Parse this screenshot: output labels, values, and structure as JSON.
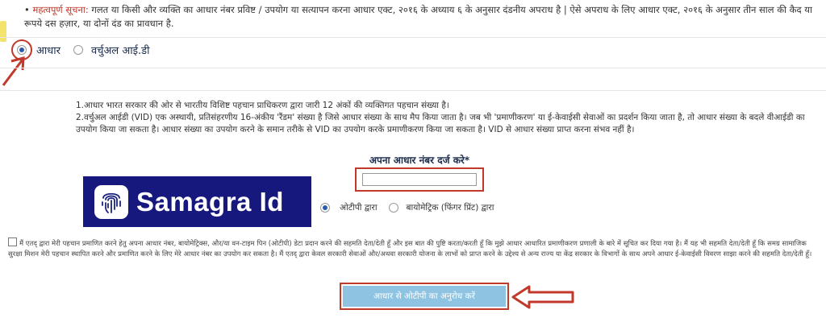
{
  "notice": {
    "label": "महत्वपूर्ण सूचना:",
    "text": "गलत या किसी और व्यक्ति का आधार नंबर प्रविष्ट / उपयोग या सत्यापन करना आधार एक्ट, २०१६ के अध्याय ६ के अनुसार दंडनीय अपराध है | ऐसे अपराध के लिए आधार एक्ट, २०१६ के अनुसार तीन साल की कैद या रूपये दस हज़ार, या दोनों दंड का प्रावधान है."
  },
  "id_type": {
    "options": [
      {
        "label": "आधार",
        "selected": true
      },
      {
        "label": "वर्चुअल आई.डी",
        "selected": false
      }
    ]
  },
  "info": {
    "line1": "1.आधार भारत सरकार की ओर से भारतीय विशिष्ट पहचान प्राधिकरण द्वारा जारी 12 अंकों की व्यक्तिगत पहचान संख्या है।",
    "line2": "2.वर्चुअल आईडी (VID) एक अस्थायी, प्रतिसंहरणीय 16-अंकीय 'रैंडम' संख्या है जिसे आधार संख्या के साथ मैप किया जाता है। जब भी 'प्रमाणीकरण' या ई-केवाईसी सेवाओं का प्रदर्शन किया जाता है, तो आधार संख्या के बदले वीआईडी का उपयोग किया जा सकता है। आधार संख्या का उपयोग करने के समान तरीके से VID का उपयोग करके प्रमाणीकरण किया जा सकता है। VID से आधार संख्या प्राप्त करना संभव नहीं है।"
  },
  "aadhaar_input": {
    "label": "अपना आधार नंबर दर्ज करे*",
    "value": "",
    "placeholder": ""
  },
  "logo": {
    "text": "Samagra Id",
    "icon": "fingerprint-icon"
  },
  "auth_method": {
    "options": [
      {
        "label": "ओटीपी द्वारा",
        "selected": true
      },
      {
        "label": "बायोमेट्रिक (फिंगर प्रिंट) द्वारा",
        "selected": false
      }
    ]
  },
  "consent": {
    "checked": false,
    "text": "मैं एतद् द्वारा मेरी पहचान प्रमाणित करने हेतु अपना आधार नंबर, बायोमेट्रिक्स, और/या वन-टाइम पिन (ओटीपी) डेटा प्रदान करने की सहमति देता/देती हूँ और इस बात की पुष्टि करता/करती हूँ कि मुझे आधार आधारित प्रमाणीकरण प्रणाली के बारे में सूचित कर दिया गया है। मैं यह भी सहमति देता/देती हूँ कि समग्र सामाजिक सुरक्षा मिशन मेरी पहचान स्थापित करने और प्रमाणित करने के लिए मेरे आधार नंबर का उपयोग कर सकता है। मैं एतद् द्वारा केवल सरकारी सेवाओं और/अथवा सरकारी योजना के लाभों को प्राप्त करने के उद्देश्य से अन्य राज्य या केंद्र सरकार के विभागों के साथ अपने आधार ई-केवाईसी विवरण साझा करने की सहमति देता/देती हूँ।"
  },
  "submit": {
    "label": "आधार से ओटीपी का अनुरोध करें"
  },
  "colors": {
    "annotation_red": "#c0392b",
    "banner_blue": "#17187e",
    "button_blue": "#8ec3e2"
  }
}
